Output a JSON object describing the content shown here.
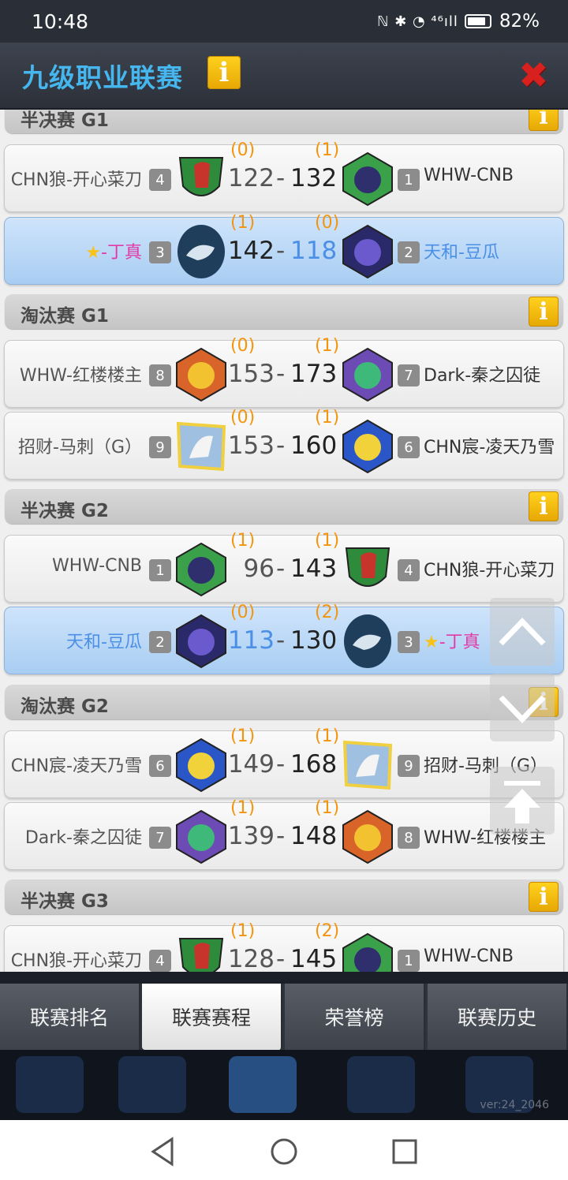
{
  "status_bar": {
    "time": "10:48",
    "signal_icons": "ℕ ✱ ◔ ⁴⁶ıll",
    "battery": "82%"
  },
  "header": {
    "title": "九级职业联赛",
    "info_label": "i",
    "close_label": "✖"
  },
  "sections": [
    {
      "title": "半决赛 G1",
      "info_label": "i",
      "matches": [
        {
          "left": {
            "name": "CHN狼-开心菜刀",
            "seed": "4",
            "team_logo": "spartan-helmet-icon"
          },
          "right": {
            "name": "WHW-CNB",
            "seed": "1",
            "team_logo": "boar-icon"
          },
          "left_score": "122",
          "right_score": "132",
          "left_wins": "(0)",
          "right_wins": "(1)",
          "highlight": false
        },
        {
          "left": {
            "name": "-丁真",
            "star": "★",
            "seed": "3",
            "team_logo": "snow-leopard-icon"
          },
          "right": {
            "name": "天和-豆瓜",
            "seed": "2",
            "team_logo": "lion-icon"
          },
          "left_score": "142",
          "right_score": "118",
          "left_wins": "(1)",
          "right_wins": "(0)",
          "highlight": true
        }
      ]
    },
    {
      "title": "淘汰赛 G1",
      "info_label": "i",
      "matches": [
        {
          "left": {
            "name": "WHW-红楼楼主",
            "seed": "8",
            "team_logo": "tiger-icon"
          },
          "right": {
            "name": "Dark-秦之囚徒",
            "seed": "7",
            "team_logo": "unicorn-purple-icon"
          },
          "left_score": "153",
          "right_score": "173",
          "left_wins": "(0)",
          "right_wins": "(1)",
          "highlight": false
        },
        {
          "left": {
            "name": "招财-马刺（G）",
            "seed": "9",
            "team_logo": "unicorn-square-icon"
          },
          "right": {
            "name": "CHN宸-凌天乃雪",
            "seed": "6",
            "team_logo": "unicorn-blue-icon"
          },
          "left_score": "153",
          "right_score": "160",
          "left_wins": "(0)",
          "right_wins": "(1)",
          "highlight": false
        }
      ]
    },
    {
      "title": "半决赛 G2",
      "info_label": "i",
      "matches": [
        {
          "left": {
            "name": "WHW-CNB",
            "seed": "1",
            "team_logo": "boar-icon"
          },
          "right": {
            "name": "CHN狼-开心菜刀",
            "seed": "4",
            "team_logo": "spartan-helmet-icon"
          },
          "left_score": "96 ",
          "right_score": "143",
          "left_wins": "(1)",
          "right_wins": "(1)",
          "highlight": false
        },
        {
          "left": {
            "name": "天和-豆瓜",
            "seed": "2",
            "team_logo": "lion-icon"
          },
          "right": {
            "name": "-丁真",
            "star": "★",
            "seed": "3",
            "team_logo": "snow-leopard-icon"
          },
          "left_score": "113",
          "right_score": "130",
          "left_wins": "(0)",
          "right_wins": "(2)",
          "highlight": true
        }
      ]
    },
    {
      "title": "淘汰赛 G2",
      "info_label": "i",
      "matches": [
        {
          "left": {
            "name": "CHN宸-凌天乃雪",
            "seed": "6",
            "team_logo": "unicorn-blue-icon"
          },
          "right": {
            "name": "招财-马刺（G）",
            "seed": "9",
            "team_logo": "unicorn-square-icon"
          },
          "left_score": "149",
          "right_score": "168",
          "left_wins": "(1)",
          "right_wins": "(1)",
          "highlight": false
        },
        {
          "left": {
            "name": "Dark-秦之囚徒",
            "seed": "7",
            "team_logo": "unicorn-purple-icon"
          },
          "right": {
            "name": "WHW-红楼楼主",
            "seed": "8",
            "team_logo": "tiger-icon"
          },
          "left_score": "139",
          "right_score": "148",
          "left_wins": "(1)",
          "right_wins": "(1)",
          "highlight": false
        }
      ]
    },
    {
      "title": "半决赛 G3",
      "info_label": "i",
      "matches": [
        {
          "left": {
            "name": "CHN狼-开心菜刀",
            "seed": "4",
            "team_logo": "spartan-helmet-icon"
          },
          "right": {
            "name": "WHW-CNB",
            "seed": "1",
            "team_logo": "boar-icon"
          },
          "left_score": "128",
          "right_score": "145",
          "left_wins": "(1)",
          "right_wins": "(2)",
          "highlight": false
        }
      ]
    }
  ],
  "tabs": [
    {
      "label": "联赛排名",
      "active": false
    },
    {
      "label": "联赛赛程",
      "active": true
    },
    {
      "label": "荣誉榜",
      "active": false
    },
    {
      "label": "联赛历史",
      "active": false
    }
  ],
  "version": "ver:24_2046",
  "colors": {
    "title_blue": "#46b6ee",
    "win_orange": "#f2940d",
    "highlight_blue": "#4b8fe6",
    "pink_name": "#e23aa6",
    "info_yellow": "#ffd21e"
  }
}
